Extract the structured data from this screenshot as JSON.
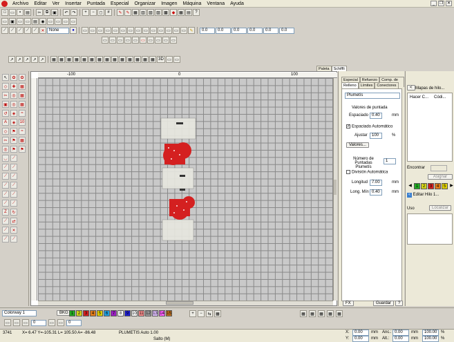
{
  "menu": [
    "Archivo",
    "Editar",
    "Ver",
    "Insertar",
    "Puntada",
    "Especial",
    "Organizar",
    "Imagen",
    "Máquina",
    "Ventana",
    "Ayuda"
  ],
  "toolbar": {
    "thread_none": "None",
    "zero_values": [
      "0.0",
      "0.0",
      "0.0",
      "0.0",
      "0.0",
      "0.0"
    ]
  },
  "ruler": {
    "h_labels": [
      "-100",
      "0",
      "100"
    ]
  },
  "docked_tabs": {
    "a": "Paleta",
    "b": "Schiffli"
  },
  "props": {
    "tabs_row1": [
      "Especial",
      "Refuerzo",
      "Comp. de tire"
    ],
    "tabs_row2": [
      "Relleno",
      "Límites",
      "Conectores"
    ],
    "stitch_type": "Plumetís",
    "section_title": "Valores de puntada",
    "spacing_label": "Espaciado",
    "spacing_value": "0.40",
    "unit_mm": "mm",
    "auto_spacing_label": "Espaciado Automático",
    "adjust_label": "Ajustar",
    "adjust_value": "100",
    "unit_pct": "%",
    "values_button": "Valores...",
    "num_label": "Número de Puntadas Plumetís",
    "num_value": "1",
    "auto_div_label": "División Automática",
    "length_label": "Longitud",
    "length_value": "7.00",
    "minlen_label": "Long. Mín",
    "minlen_value": "0.40",
    "fx": "FX",
    "save": "Guardar",
    "help": "?"
  },
  "far": {
    "maps_btn": "Mapas de hilo...",
    "col1": "Hacer C...",
    "col2": "Códi...",
    "find_label": "Encontrar",
    "assign_btn": "Asignar",
    "edit_thread_btn": "Editar Hilo 1...",
    "use_label": "Uso",
    "locate_btn": "Localizar",
    "chips": [
      "1",
      "2",
      "3",
      "4",
      "5"
    ]
  },
  "bottom": {
    "colorway": "Colorway 1",
    "bkg": "BKG",
    "chip_labels": [
      "1",
      "2",
      "3",
      "4",
      "5",
      "6",
      "7",
      "8",
      "9",
      "10",
      "11",
      "12",
      "13",
      "14",
      "15"
    ],
    "chip_colors": [
      "#22aa22",
      "#d4d41a",
      "#d42020",
      "#e07b1a",
      "#e0d000",
      "#20a0e0",
      "#9a20c0",
      "#ffffff",
      "#2020d0",
      "#ffffff",
      "#ff9090",
      "#a0a0a0",
      "#e0c0ff",
      "#ff60ff",
      "#c07020"
    ],
    "zero_a": "0",
    "zero_b": "0"
  },
  "status": {
    "count": "3741",
    "coords": "X= 6.47 Y=-105.31 L= 105.50 A= -86.48",
    "mode": "PLUMETIS Auto  1.00",
    "jump": "Salto (M)",
    "x_label": "X:",
    "y_label": "Y:",
    "x_val": "0.00",
    "y_val": "0.00",
    "anc_label": "Anc.:",
    "alt_label": "Alt.:",
    "anc_val": "0.00",
    "alt_val": "0.00",
    "unit": "mm",
    "pct1": "100.00",
    "pct2": "100.00",
    "pct_unit": "%"
  }
}
